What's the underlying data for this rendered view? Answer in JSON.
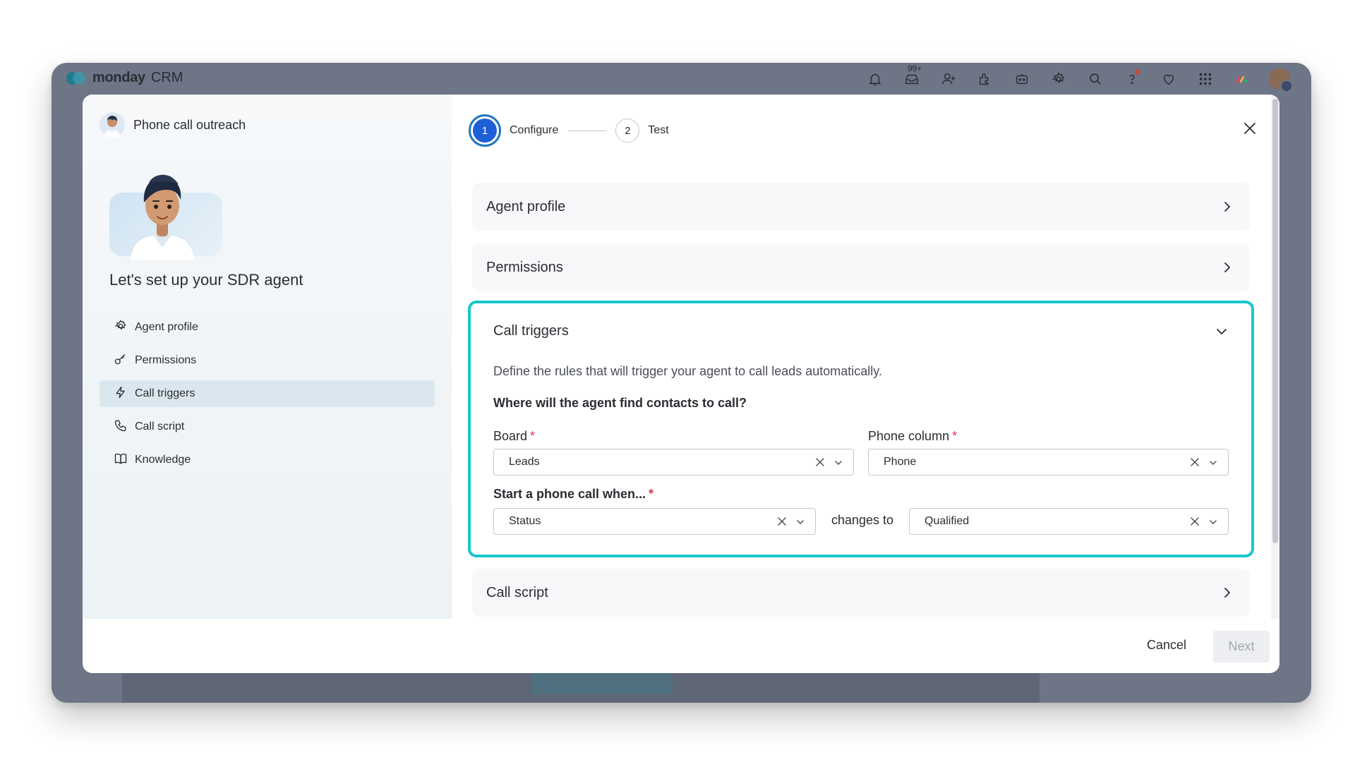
{
  "app": {
    "brand_name": "monday",
    "brand_sub": "CRM",
    "inbox_badge": "99+",
    "top_icons": [
      "bell-icon",
      "inbox-icon",
      "invite-user-icon",
      "apps-icon",
      "ai-bot-icon",
      "settings-icon",
      "search-icon",
      "help-icon",
      "favorites-icon",
      "app-grid-icon",
      "product-switcher-icon",
      "user-avatar"
    ]
  },
  "modal": {
    "left": {
      "title": "Phone call outreach",
      "heading": "Let's set up your SDR agent",
      "nav": [
        {
          "label": "Agent profile",
          "icon": "gear-icon",
          "active": false
        },
        {
          "label": "Permissions",
          "icon": "key-icon",
          "active": false
        },
        {
          "label": "Call triggers",
          "icon": "lightning-icon",
          "active": true
        },
        {
          "label": "Call script",
          "icon": "phone-icon",
          "active": false
        },
        {
          "label": "Knowledge",
          "icon": "book-icon",
          "active": false
        }
      ]
    },
    "stepper": {
      "steps": [
        {
          "number": "1",
          "label": "Configure",
          "active": true
        },
        {
          "number": "2",
          "label": "Test",
          "active": false
        }
      ]
    },
    "sections": {
      "agent_profile": "Agent profile",
      "permissions": "Permissions",
      "call_script": "Call script"
    },
    "call_triggers": {
      "title": "Call triggers",
      "description": "Define the rules that will trigger your agent to call leads automatically.",
      "question": "Where will the agent find contacts to call?",
      "board_label": "Board",
      "board_value": "Leads",
      "phone_label": "Phone column",
      "phone_value": "Phone",
      "start_label": "Start a phone call when...",
      "start_column_value": "Status",
      "changes_to": "changes to",
      "start_target_value": "Qualified",
      "required_mark": "*"
    },
    "footer": {
      "cancel_label": "Cancel",
      "next_label": "Next"
    }
  },
  "colors": {
    "accent": "#17c8cf",
    "primary": "#1f5fd6",
    "required": "#d83a52"
  }
}
